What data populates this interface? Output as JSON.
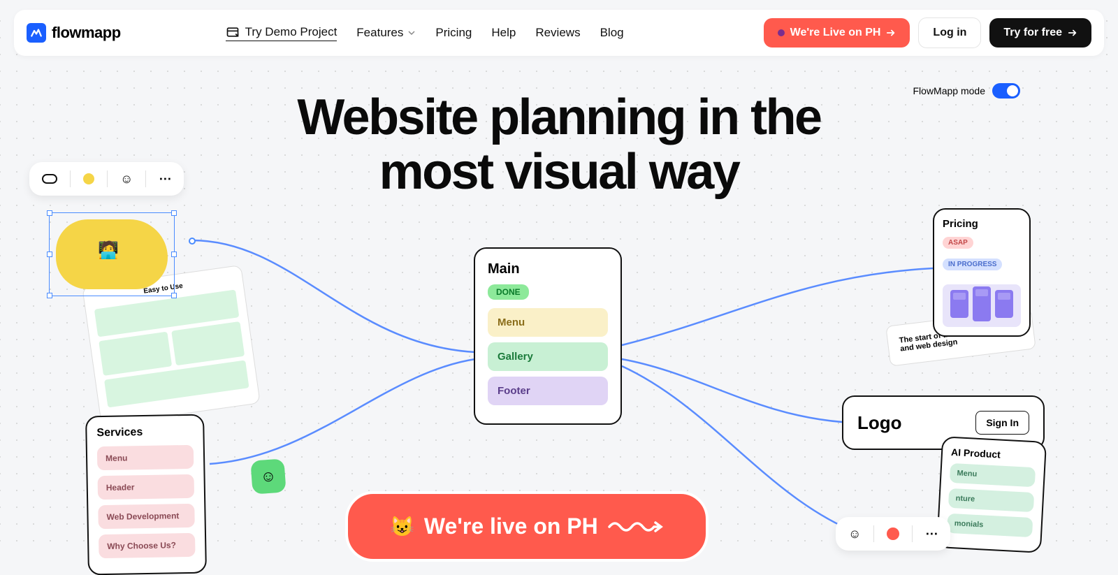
{
  "brand": "flowmapp",
  "nav": {
    "try_demo": "Try Demo Project",
    "features": "Features",
    "pricing": "Pricing",
    "help": "Help",
    "reviews": "Reviews",
    "blog": "Blog"
  },
  "header_buttons": {
    "ph": "We're Live on PH",
    "login": "Log in",
    "free": "Try for free"
  },
  "mode": {
    "label": "FlowMapp mode",
    "on": true
  },
  "hero": {
    "line1": "Website planning in the",
    "line2": "most visual way"
  },
  "main_card": {
    "title": "Main",
    "status": "DONE",
    "rows": [
      "Menu",
      "Gallery",
      "Footer"
    ]
  },
  "services_card": {
    "title": "Services",
    "rows": [
      "Menu",
      "Header",
      "Web Development",
      "Why Choose Us?"
    ]
  },
  "pricing_card": {
    "title": "Pricing",
    "badges": [
      "ASAP",
      "IN PROGRESS"
    ]
  },
  "logo_card": {
    "text": "Logo",
    "signin": "Sign In"
  },
  "ai_card": {
    "title": "AI Product",
    "rows": [
      "Menu",
      "nture",
      "monials"
    ]
  },
  "wireframe": {
    "title": "Easy to Use"
  },
  "text_card": {
    "line1": "The start of the web",
    "line2": "and web design"
  },
  "ph_banner": "We're live on PH"
}
